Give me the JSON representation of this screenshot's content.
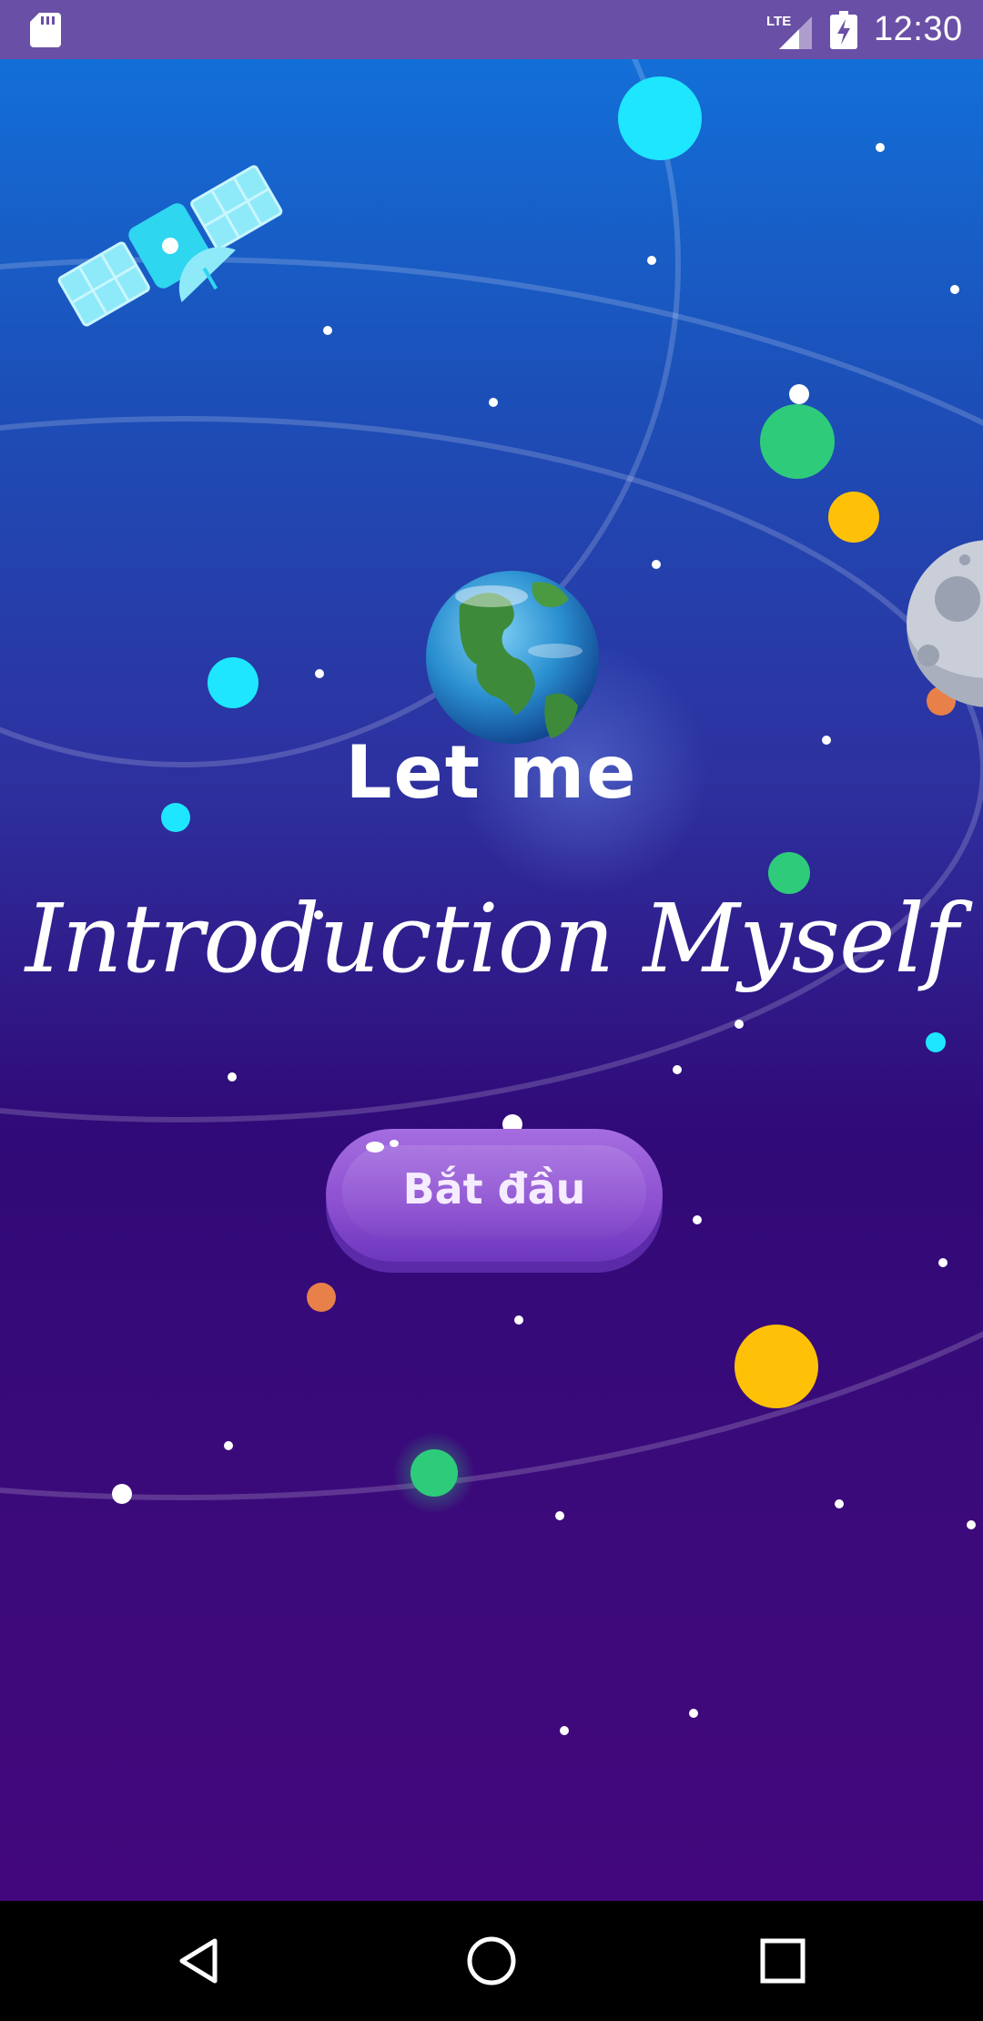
{
  "status_bar": {
    "time": "12:30",
    "network_label": "LTE",
    "icons": [
      "sd-card-icon",
      "cell-signal-icon",
      "battery-charging-icon"
    ]
  },
  "hero": {
    "line1": "Let me",
    "line2": "Introduction Myself"
  },
  "start_button": {
    "label": "Bắt đầu"
  },
  "navigation_bar": {
    "icons": [
      "back-icon",
      "home-icon",
      "recents-icon"
    ]
  },
  "colors": {
    "status_bar": "#6a4fa6",
    "background_top": "#136fd8",
    "background_bottom": "#42077c",
    "button": "#8b4ed0",
    "planet_cyan": "#1fe6ff",
    "planet_green": "#2ecc7a",
    "planet_yellow": "#ffc107",
    "planet_orange": "#e8804a"
  }
}
